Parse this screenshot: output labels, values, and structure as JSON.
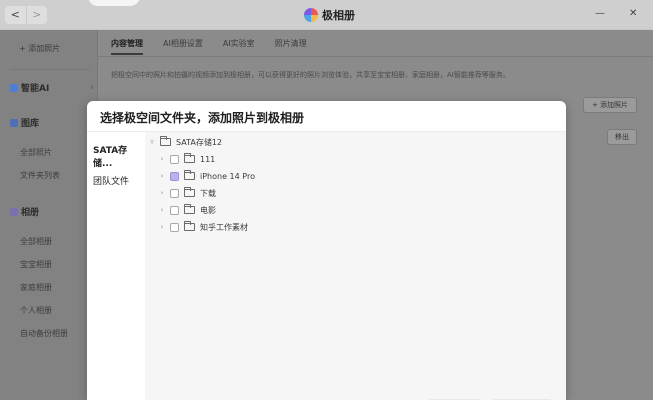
{
  "window": {
    "title": "极相册",
    "nav_back": "<",
    "nav_forward": ">",
    "minimize": "—",
    "close": "✕"
  },
  "sidebar": {
    "add_photo": "+ 添加照片",
    "sections": [
      {
        "title": "智能AI",
        "arrow": "›"
      },
      {
        "title": "图库"
      },
      {
        "title": "相册"
      }
    ],
    "gallery_items": [
      "全部照片",
      "文件夹列表"
    ],
    "album_items": [
      "全部相册",
      "宝宝相册",
      "家庭相册",
      "个人相册",
      "自动备份相册"
    ]
  },
  "main": {
    "tabs": [
      "内容管理",
      "AI相册设置",
      "AI实验室",
      "照片清理"
    ],
    "description": "把极空间中的照片和拍摄的视频添加到极相册，可以获得更好的照片浏览体验，共享至宝宝相册、家庭相册，AI智能推荐等服务。",
    "add_photo_button": "+ 添加照片",
    "remove_button": "移出"
  },
  "modal": {
    "title": "选择极空间文件夹，添加照片到极相册",
    "sources": [
      "SATA存储...",
      "团队文件"
    ],
    "tree_root": "SATA存储12",
    "folders": [
      {
        "name": "111",
        "state": "unchecked"
      },
      {
        "name": "iPhone 14 Pro",
        "state": "partial"
      },
      {
        "name": "下载",
        "state": "unchecked"
      },
      {
        "name": "电影",
        "state": "unchecked"
      },
      {
        "name": "知乎工作素材",
        "state": "unchecked"
      }
    ]
  },
  "colors": {
    "accent_partial": "#b8b3e8",
    "overlay": "#8b8b8b"
  }
}
